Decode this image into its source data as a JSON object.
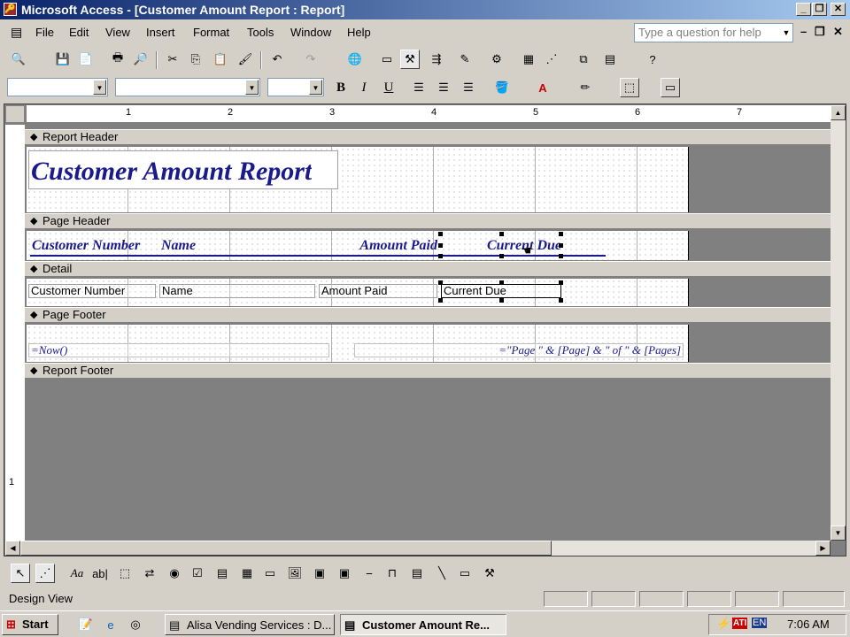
{
  "window": {
    "title": "Microsoft Access - [Customer Amount Report : Report]",
    "minimize": "_",
    "restore": "❐",
    "close": "✕"
  },
  "menu": {
    "items": [
      "File",
      "Edit",
      "View",
      "Insert",
      "Format",
      "Tools",
      "Window",
      "Help"
    ],
    "ask_placeholder": "Type a question for help"
  },
  "toolbar": {
    "font_name": "",
    "font_size": "",
    "object_name": "",
    "bold": "B",
    "italic": "I",
    "underline": "U"
  },
  "ruler": {
    "marks": [
      "1",
      "2",
      "3",
      "4",
      "5",
      "6",
      "7"
    ]
  },
  "vruler": {
    "marks": [
      "1"
    ]
  },
  "sections": {
    "report_header": "Report Header",
    "page_header": "Page Header",
    "detail": "Detail",
    "page_footer": "Page Footer",
    "report_footer": "Report Footer"
  },
  "report_header": {
    "title": "Customer Amount Report"
  },
  "page_header": {
    "labels": [
      "Customer Number",
      "Name",
      "Amount Paid",
      "Current Due"
    ]
  },
  "detail": {
    "fields": [
      "Customer Number",
      "Name",
      "Amount Paid",
      "Current Due"
    ]
  },
  "page_footer": {
    "left": "=Now()",
    "right": "=\"Page \" & [Page] & \" of \" & [Pages]"
  },
  "status": {
    "text": "Design View"
  },
  "taskbar": {
    "start": "Start",
    "tasks": [
      "Alisa Vending Services : D...",
      "Customer Amount Re..."
    ],
    "lang": "EN",
    "clock": "7:06 AM"
  },
  "colors": {
    "title_bar": "#0a246a",
    "design_label": "#1a1a8c",
    "gray_area": "#808080"
  }
}
